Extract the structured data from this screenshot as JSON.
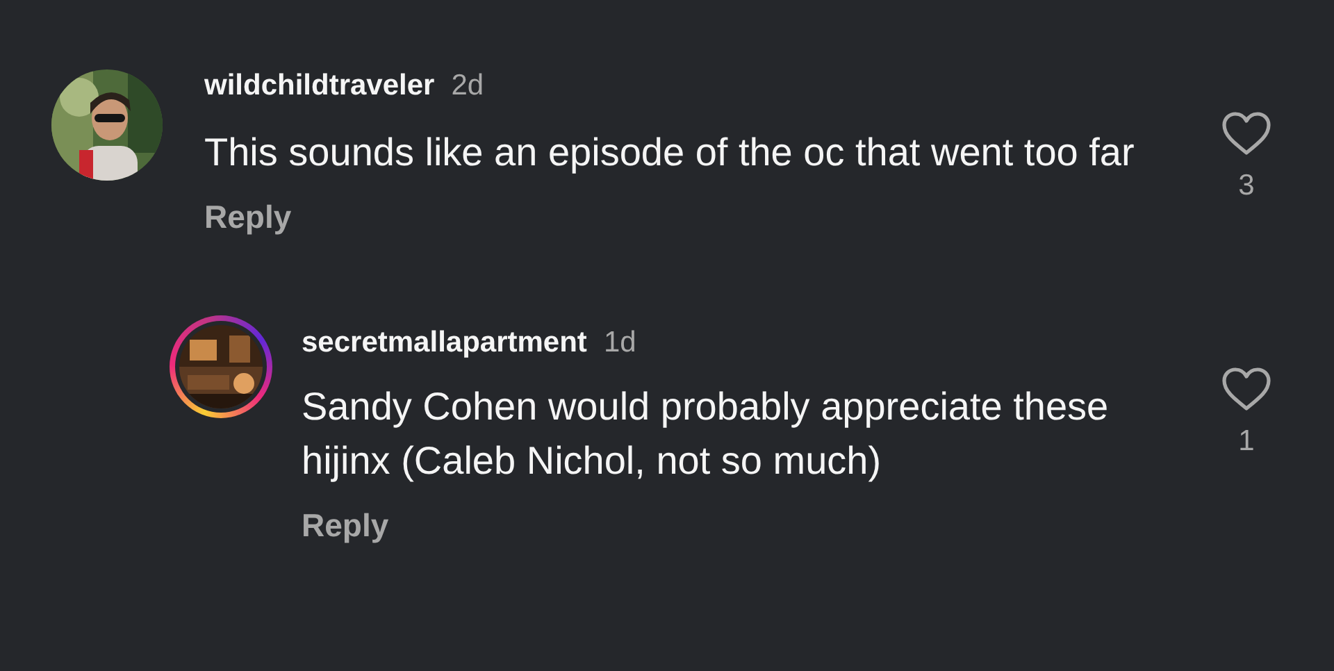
{
  "comments": [
    {
      "kind": "comment",
      "username": "wildchildtraveler",
      "time": "2d",
      "text": "This sounds like an episode of the oc that went too far",
      "reply_label": "Reply",
      "likes": "3",
      "liked": false,
      "story_ring": false
    },
    {
      "kind": "reply",
      "username": "secretmallapartment",
      "time": "1d",
      "text": "Sandy Cohen would probably appreciate these hijinx (Caleb Nichol, not so much)",
      "reply_label": "Reply",
      "likes": "1",
      "liked": false,
      "story_ring": true
    }
  ]
}
